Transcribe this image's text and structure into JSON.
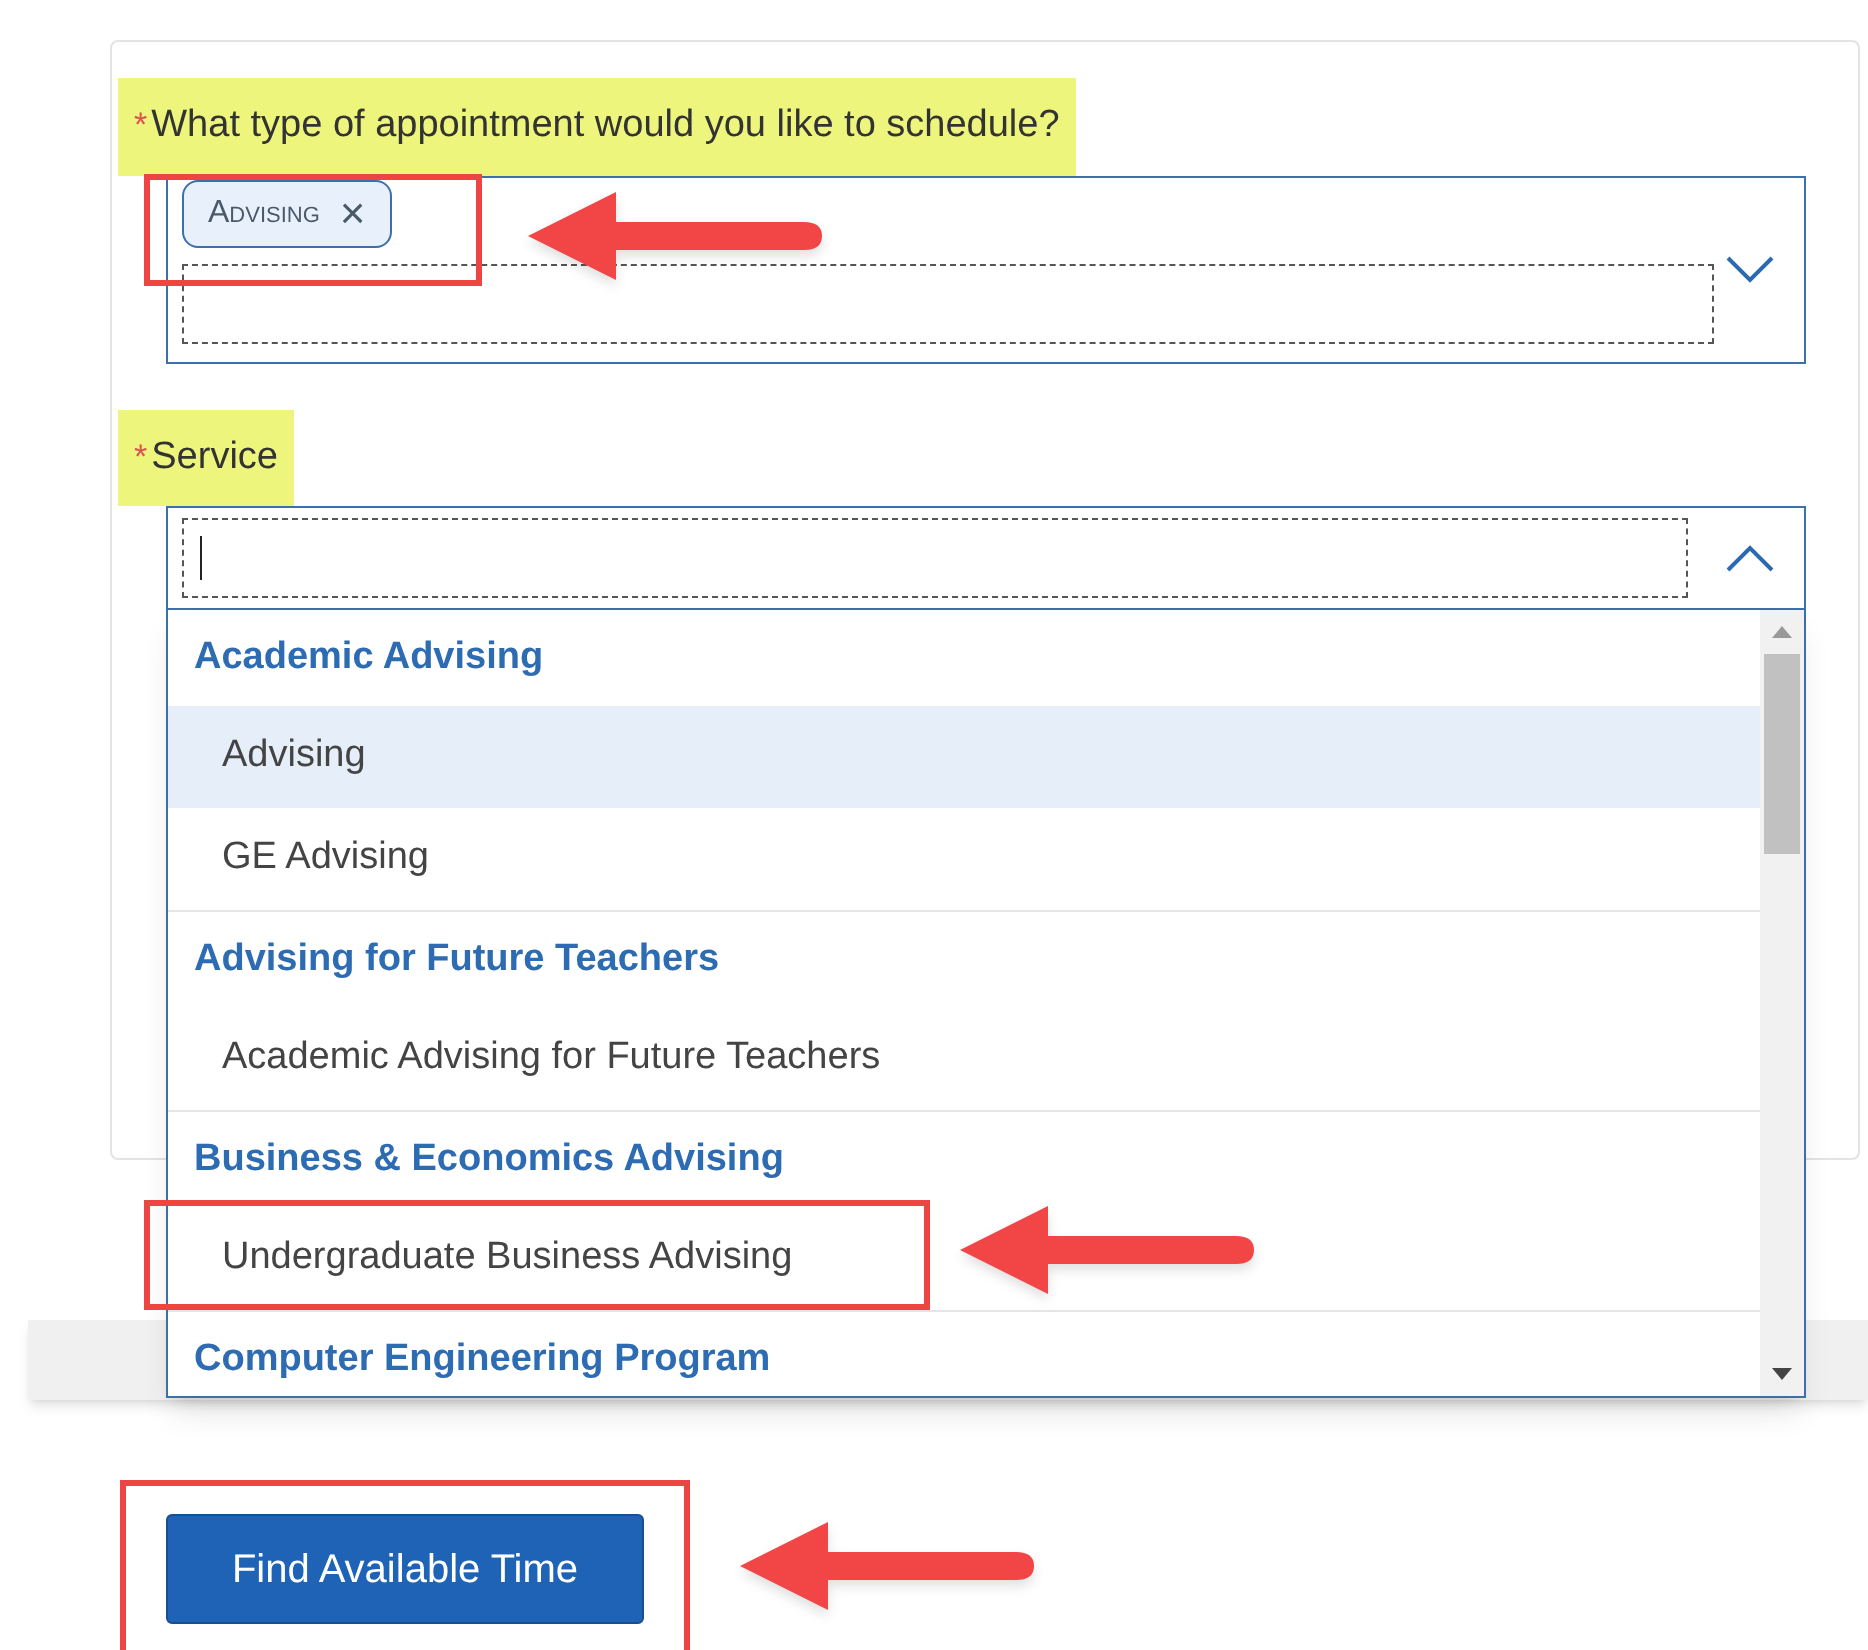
{
  "appointment_type": {
    "required_mark": "*",
    "label": "What type of appointment would you like to schedule?",
    "tags": [
      {
        "label": "Advising",
        "remove": "×"
      }
    ],
    "expanded": false
  },
  "service": {
    "required_mark": "*",
    "label": "Service",
    "expanded": true,
    "groups": [
      {
        "label": "Academic Advising",
        "items": [
          {
            "label": "Advising",
            "selected": true
          },
          {
            "label": "GE Advising",
            "selected": false
          }
        ]
      },
      {
        "label": "Advising for Future Teachers",
        "items": [
          {
            "label": "Academic Advising for Future Teachers",
            "selected": false
          }
        ]
      },
      {
        "label": "Business & Economics Advising",
        "items": [
          {
            "label": "Undergraduate Business Advising",
            "selected": false
          }
        ]
      },
      {
        "label": "Computer Engineering Program"
      }
    ]
  },
  "find_button": "Find Available Time"
}
